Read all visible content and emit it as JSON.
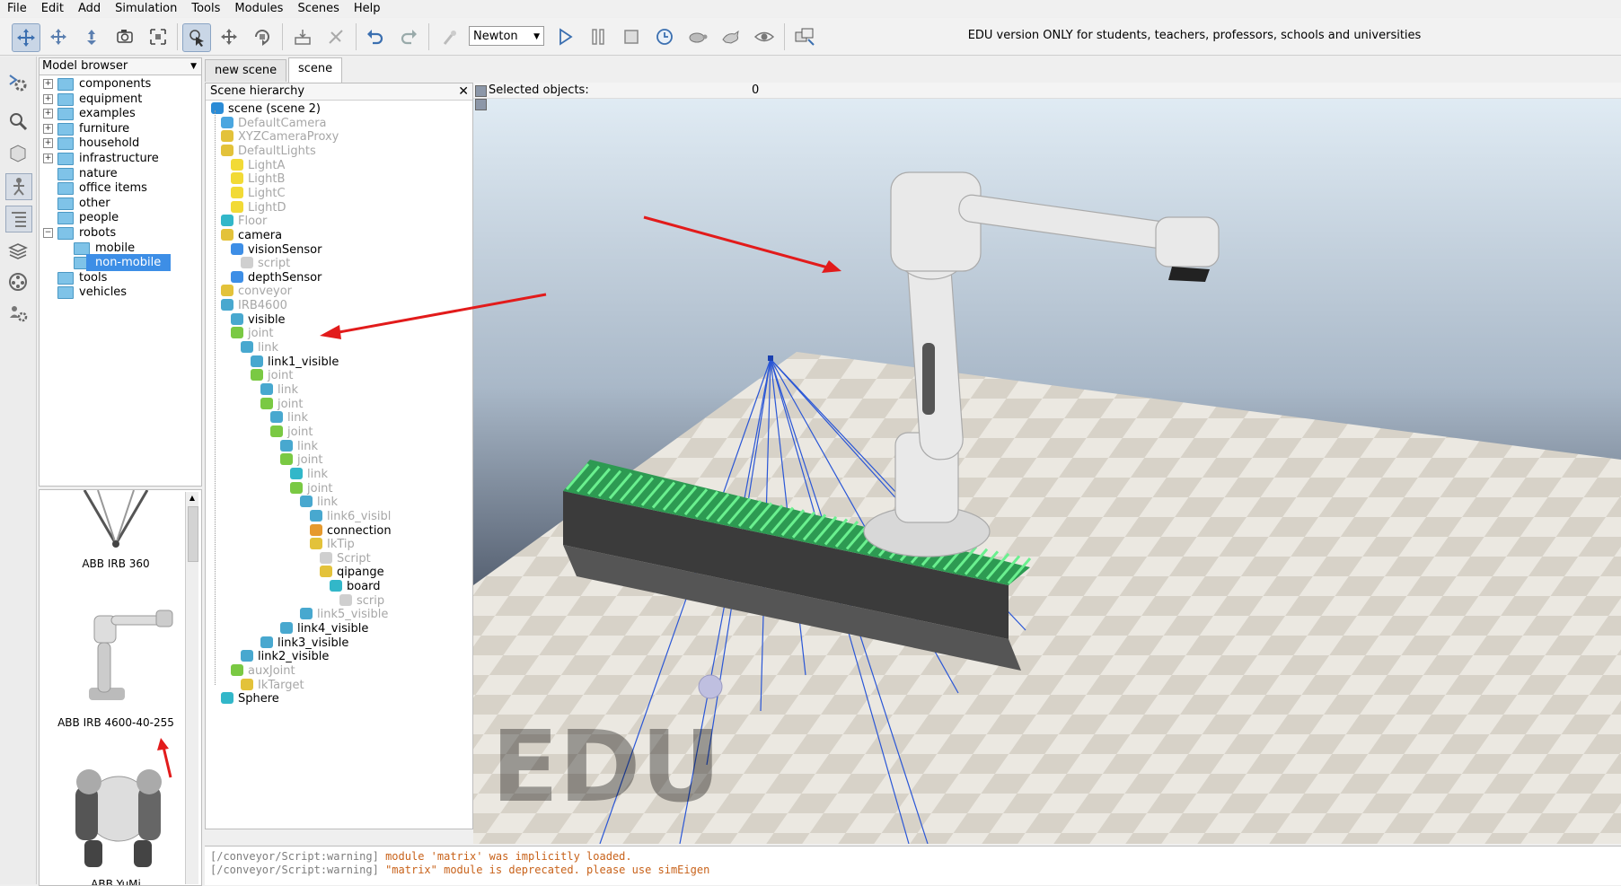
{
  "menu": [
    "File",
    "Edit",
    "Add",
    "Simulation",
    "Tools",
    "Modules",
    "Scenes",
    "Help"
  ],
  "toolbar": {
    "engine": "Newton",
    "edu_note": "EDU version ONLY for students, teachers, professors, schools and universities"
  },
  "model_browser": {
    "title": "Model browser",
    "items": [
      {
        "label": "components",
        "expander": "+"
      },
      {
        "label": "equipment",
        "expander": "+"
      },
      {
        "label": "examples",
        "expander": "+"
      },
      {
        "label": "furniture",
        "expander": "+"
      },
      {
        "label": "household",
        "expander": "+"
      },
      {
        "label": "infrastructure",
        "expander": "+"
      },
      {
        "label": "nature",
        "expander": ""
      },
      {
        "label": "office items",
        "expander": ""
      },
      {
        "label": "other",
        "expander": ""
      },
      {
        "label": "people",
        "expander": ""
      },
      {
        "label": "robots",
        "expander": "−"
      },
      {
        "label": "mobile",
        "expander": ""
      },
      {
        "label": "non-mobile",
        "expander": "",
        "selected": true
      },
      {
        "label": "tools",
        "expander": ""
      },
      {
        "label": "vehicles",
        "expander": ""
      }
    ]
  },
  "thumbnails": [
    "ABB IRB 360",
    "ABB IRB 4600-40-255",
    "ABB YuMi"
  ],
  "tabs": [
    "new scene",
    "scene"
  ],
  "hierarchy": {
    "title": "Scene hierarchy",
    "close": "✕",
    "rows": [
      {
        "label": "scene (scene 2)",
        "dim": false,
        "icon": "scene-icon"
      },
      {
        "label": "DefaultCamera",
        "dim": true,
        "icon": "camera-icon"
      },
      {
        "label": "XYZCameraProxy",
        "dim": true,
        "icon": "dummy-icon"
      },
      {
        "label": "DefaultLights",
        "dim": true,
        "icon": "dummy-icon"
      },
      {
        "label": "LightA",
        "dim": true,
        "icon": "light-icon"
      },
      {
        "label": "LightB",
        "dim": true,
        "icon": "light-icon"
      },
      {
        "label": "LightC",
        "dim": true,
        "icon": "light-icon"
      },
      {
        "label": "LightD",
        "dim": true,
        "icon": "light-icon"
      },
      {
        "label": "Floor",
        "dim": true,
        "icon": "shape-icon"
      },
      {
        "label": "camera",
        "dim": false,
        "icon": "dummy-icon"
      },
      {
        "label": "visionSensor",
        "dim": false,
        "icon": "vision-sensor-icon"
      },
      {
        "label": "script",
        "dim": true,
        "icon": "script-icon"
      },
      {
        "label": "depthSensor",
        "dim": false,
        "icon": "vision-sensor-icon"
      },
      {
        "label": "conveyor",
        "dim": true,
        "icon": "dummy-icon"
      },
      {
        "label": "IRB4600",
        "dim": true,
        "icon": "mesh-icon"
      },
      {
        "label": "visible",
        "dim": false,
        "icon": "mesh-icon"
      },
      {
        "label": "joint",
        "dim": true,
        "icon": "joint-icon"
      },
      {
        "label": "link",
        "dim": true,
        "icon": "mesh-icon"
      },
      {
        "label": "link1_visible",
        "dim": false,
        "icon": "mesh-icon"
      },
      {
        "label": "joint",
        "dim": true,
        "icon": "joint-icon"
      },
      {
        "label": "link",
        "dim": true,
        "icon": "mesh-icon"
      },
      {
        "label": "joint",
        "dim": true,
        "icon": "joint-icon"
      },
      {
        "label": "link",
        "dim": true,
        "icon": "mesh-icon"
      },
      {
        "label": "joint",
        "dim": true,
        "icon": "joint-icon"
      },
      {
        "label": "link",
        "dim": true,
        "icon": "mesh-icon"
      },
      {
        "label": "joint",
        "dim": true,
        "icon": "joint-icon"
      },
      {
        "label": "link",
        "dim": true,
        "icon": "shape-icon"
      },
      {
        "label": "joint",
        "dim": true,
        "icon": "joint-icon"
      },
      {
        "label": "link",
        "dim": true,
        "icon": "mesh-icon"
      },
      {
        "label": "link6_visibl",
        "dim": true,
        "icon": "mesh-icon"
      },
      {
        "label": "connection",
        "dim": false,
        "icon": "force-sensor-icon"
      },
      {
        "label": "IkTip",
        "dim": true,
        "icon": "dummy-icon"
      },
      {
        "label": "Script",
        "dim": true,
        "icon": "script-icon"
      },
      {
        "label": "qipange",
        "dim": false,
        "icon": "dummy-icon"
      },
      {
        "label": "board",
        "dim": false,
        "icon": "shape-icon"
      },
      {
        "label": "scrip",
        "dim": true,
        "icon": "script-icon"
      },
      {
        "label": "link5_visible",
        "dim": true,
        "icon": "mesh-icon"
      },
      {
        "label": "link4_visible",
        "dim": false,
        "icon": "mesh-icon"
      },
      {
        "label": "link3_visible",
        "dim": false,
        "icon": "mesh-icon"
      },
      {
        "label": "link2_visible",
        "dim": false,
        "icon": "mesh-icon"
      },
      {
        "label": "auxJoint",
        "dim": true,
        "icon": "joint-icon"
      },
      {
        "label": "IkTarget",
        "dim": true,
        "icon": "dummy-icon"
      },
      {
        "label": "Sphere",
        "dim": false,
        "icon": "shape-icon"
      }
    ]
  },
  "viewport": {
    "selected_label": "Selected objects:",
    "selected_count": "0",
    "watermark": "EDU"
  },
  "console": [
    {
      "prefix": "[/conveyor/Script:warning]",
      "message": "module 'matrix' was implicitly loaded."
    },
    {
      "prefix": "[/conveyor/Script:warning]",
      "message": "\"matrix\" module is deprecated. please use simEigen"
    }
  ],
  "colors": {
    "accent": "#3d8ee6",
    "annotation_arrow": "#e21b1b",
    "conveyor_green": "#37c96a",
    "console_warning": "#c8621a"
  }
}
